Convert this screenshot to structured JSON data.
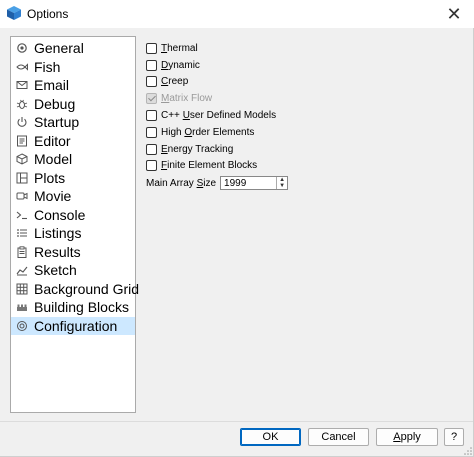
{
  "window": {
    "title": "Options",
    "close_glyph": "✕"
  },
  "nav": {
    "selected_index": 16,
    "items": [
      {
        "label": "General",
        "icon": "gear-icon"
      },
      {
        "label": "Fish",
        "icon": "fish-icon"
      },
      {
        "label": "Email",
        "icon": "email-icon"
      },
      {
        "label": "Debug",
        "icon": "bug-icon"
      },
      {
        "label": "Startup",
        "icon": "power-icon"
      },
      {
        "label": "Editor",
        "icon": "editor-icon"
      },
      {
        "label": "Model",
        "icon": "cube-icon"
      },
      {
        "label": "Plots",
        "icon": "plots-icon"
      },
      {
        "label": "Movie",
        "icon": "movie-icon"
      },
      {
        "label": "Console",
        "icon": "console-icon"
      },
      {
        "label": "Listings",
        "icon": "list-icon"
      },
      {
        "label": "Results",
        "icon": "clipboard-icon"
      },
      {
        "label": "Sketch",
        "icon": "sketch-icon"
      },
      {
        "label": "Background Grid",
        "icon": "grid-icon"
      },
      {
        "label": "Building Blocks",
        "icon": "blocks-icon"
      },
      {
        "label": "Configuration",
        "icon": "config-icon"
      }
    ]
  },
  "options": [
    {
      "pre": "",
      "u": "T",
      "post": "hermal",
      "checked": false,
      "disabled": false
    },
    {
      "pre": "",
      "u": "D",
      "post": "ynamic",
      "checked": false,
      "disabled": false
    },
    {
      "pre": "",
      "u": "C",
      "post": "reep",
      "checked": false,
      "disabled": false
    },
    {
      "pre": "",
      "u": "M",
      "post": "atrix Flow",
      "checked": true,
      "disabled": true
    },
    {
      "pre": "C++ ",
      "u": "U",
      "post": "ser Defined Models",
      "checked": false,
      "disabled": false
    },
    {
      "pre": "High ",
      "u": "O",
      "post": "rder Elements",
      "checked": false,
      "disabled": false
    },
    {
      "pre": "",
      "u": "E",
      "post": "nergy Tracking",
      "checked": false,
      "disabled": false
    },
    {
      "pre": "",
      "u": "F",
      "post": "inite Element Blocks",
      "checked": false,
      "disabled": false
    }
  ],
  "main_array": {
    "label_pre": "Main Array ",
    "label_u": "S",
    "label_post": "ize",
    "value": "1999"
  },
  "buttons": {
    "ok": "OK",
    "cancel": "Cancel",
    "apply_u": "A",
    "apply_post": "pply",
    "help": "?"
  }
}
